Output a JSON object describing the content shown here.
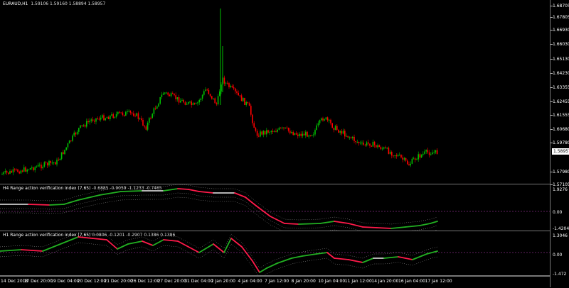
{
  "main": {
    "symbol": "EURAUD,H1",
    "ohlc": "1.59106 1.59160 1.58894 1.58957",
    "price_ticks": [
      "1.68705",
      "1.67805",
      "1.66930",
      "1.66030",
      "1.65130",
      "1.64230",
      "1.63355",
      "1.62455",
      "1.61555",
      "1.60680",
      "1.59780",
      "1.58957",
      "1.57980",
      "1.57105"
    ],
    "current_price": "1.58957",
    "colors": {
      "bull": "#00c000",
      "bear": "#ff0000"
    }
  },
  "h4": {
    "title": "H4 Range action verification index (7,65)",
    "values": "-0.6885 -0.9059 -1.1233 -0.7465",
    "ticks": [
      "1.9276",
      "0.00",
      "-1.4204"
    ]
  },
  "h1": {
    "title": "H1 Range action verification index (7,65)",
    "values": "0.0806 -0.1201 -0.2907 0.1386 0.1386",
    "ticks": [
      "1.3046",
      "0.00",
      "-1.472"
    ]
  },
  "time_labels": [
    "14 Dec 2018",
    "17 Dec 20:00",
    "19 Dec 04:00",
    "20 Dec 12:00",
    "21 Dec 20:00",
    "26 Dec 12:00",
    "27 Dec 20:00",
    "31 Dec 04:00",
    "2 Jan 20:00",
    "4 Jan 04:00",
    "7 Jan 12:00",
    "8 Jan 20:00",
    "10 Jan 04:00",
    "11 Jan 12:00",
    "14 Jan 20:00",
    "16 Jan 04:00",
    "17 Jan 12:00"
  ],
  "line_colors": {
    "up": "#22b022",
    "down": "#ff1a4a",
    "neutral": "#cccccc",
    "level": "#a0a0a0"
  }
}
